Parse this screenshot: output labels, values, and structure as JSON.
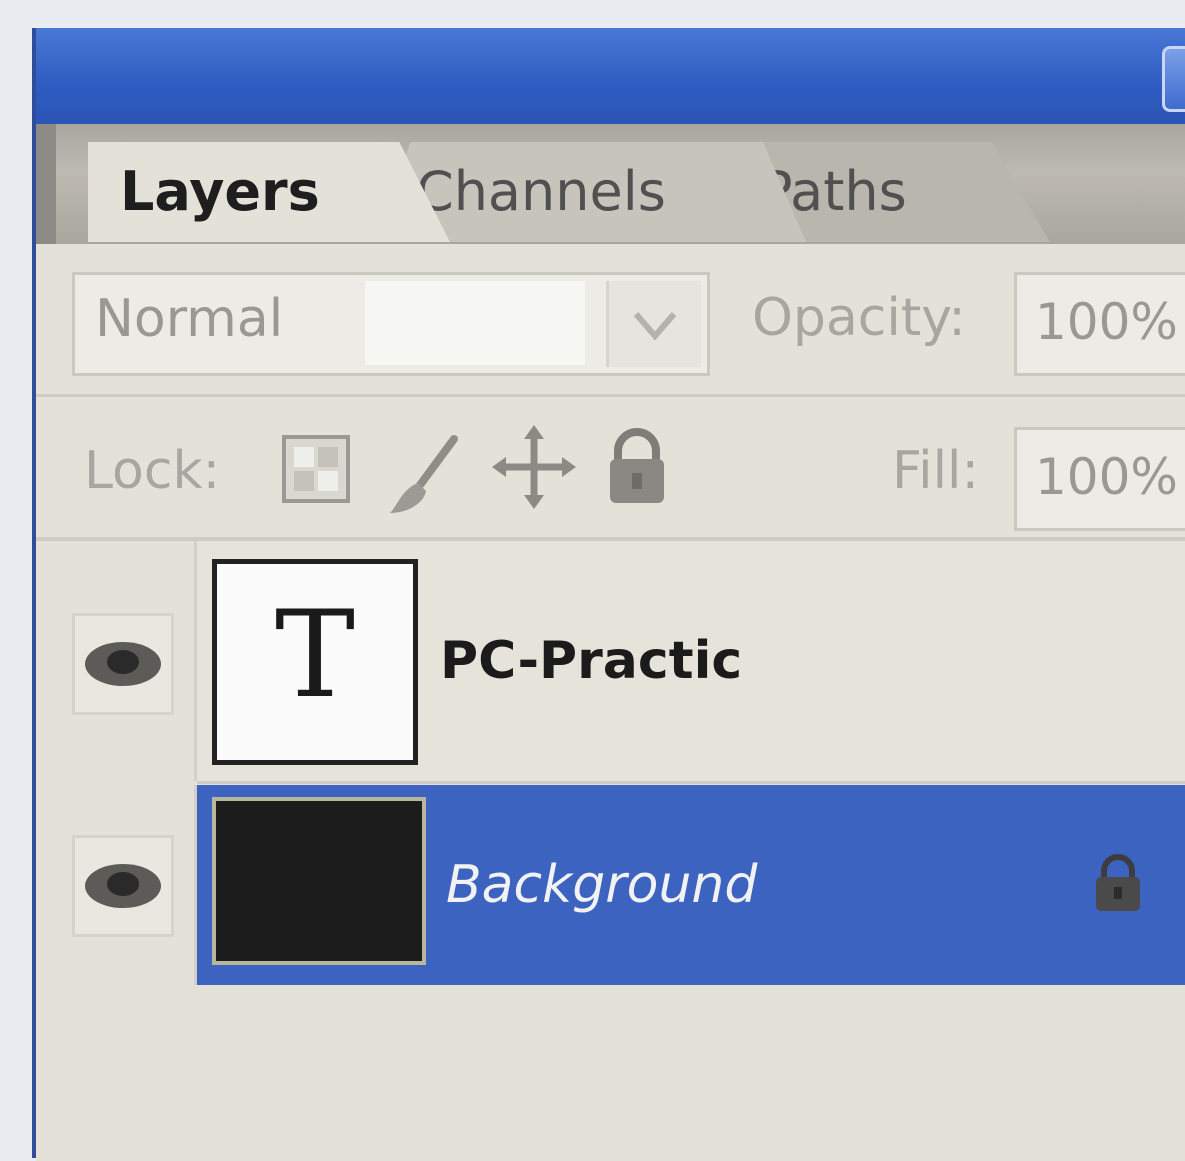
{
  "tabs": [
    "Layers",
    "Channels",
    "Paths"
  ],
  "blend_mode": {
    "value": "Normal"
  },
  "opacity": {
    "label": "Opacity:",
    "value": "100%"
  },
  "lock": {
    "label": "Lock:"
  },
  "fill": {
    "label": "Fill:",
    "value": "100%"
  },
  "layers": [
    {
      "name": "PC-Practic",
      "thumb_glyph": "T",
      "visible": true,
      "selected": false
    },
    {
      "name": "Background",
      "visible": true,
      "selected": true,
      "locked": true
    }
  ],
  "colors": {
    "title_bar": "#2f5cc0",
    "selection": "#3c63c0",
    "panel_bg": "#e4e1d8"
  }
}
